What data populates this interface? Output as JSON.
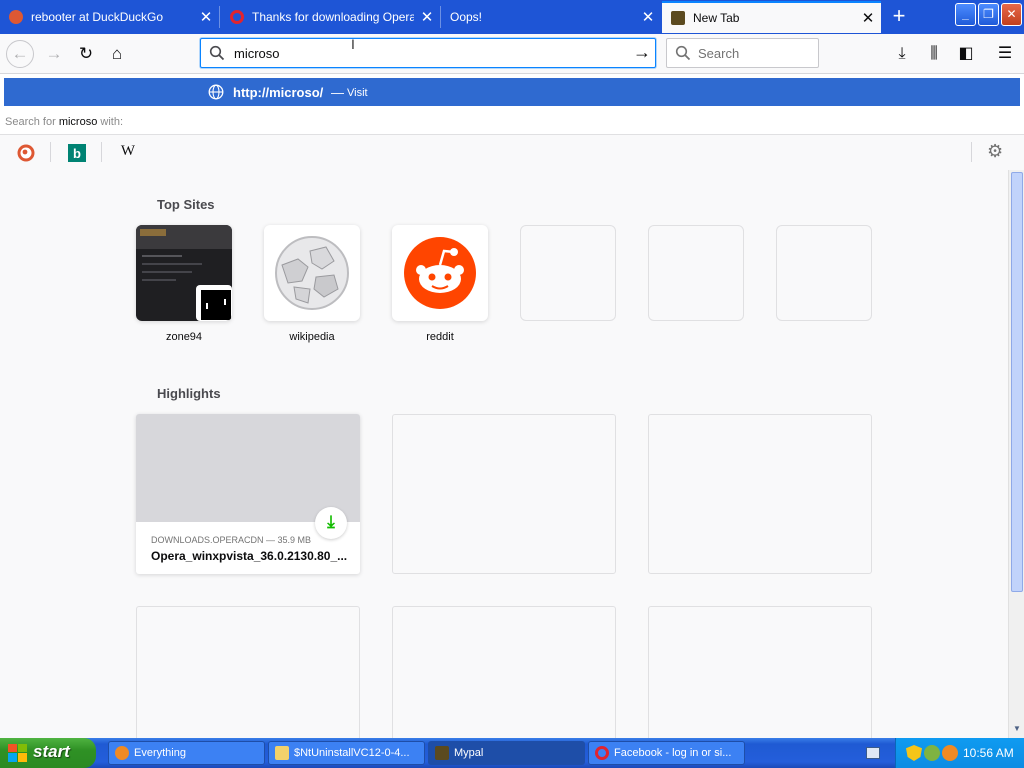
{
  "tabs": [
    {
      "title": "rebooter at DuckDuckGo",
      "icon": "duckduckgo-icon"
    },
    {
      "title": "Thanks for downloading Opera",
      "icon": "opera-icon"
    },
    {
      "title": "Oops!",
      "icon": ""
    },
    {
      "title": "New Tab",
      "icon": "mypal-icon"
    }
  ],
  "navbar": {
    "url_value": "microso",
    "search_placeholder": "Search"
  },
  "popup": {
    "heuristic_url": "http://microso/",
    "heuristic_dash": "—",
    "heuristic_action": "Visit",
    "search_for_prefix": "Search for",
    "search_for_term": "microso",
    "search_for_suffix": "with:",
    "engines": [
      "duckduckgo",
      "bing",
      "wikipedia"
    ],
    "wikipedia_glyph": "W"
  },
  "content": {
    "top_sites_title": "Top Sites",
    "top_sites": [
      {
        "label": "zone94"
      },
      {
        "label": "wikipedia"
      },
      {
        "label": "reddit"
      }
    ],
    "highlights_title": "Highlights",
    "highlight": {
      "context": "DOWNLOADS.OPERACDN — 35.9 MB",
      "title": "Opera_winxpvista_36.0.2130.80_..."
    }
  },
  "taskbar": {
    "start_label": "start",
    "items": [
      {
        "label": "Everything"
      },
      {
        "label": "$NtUninstallVC12-0-4..."
      },
      {
        "label": "Mypal"
      },
      {
        "label": "Facebook - log in or si..."
      }
    ],
    "clock": "10:56 AM"
  },
  "colors": {
    "accent": "#0a84ff",
    "highlight_row": "#2f6ad0",
    "tabstrip": "#1e55d6",
    "reddit": "#ff4500",
    "download_green": "#12bc00"
  }
}
